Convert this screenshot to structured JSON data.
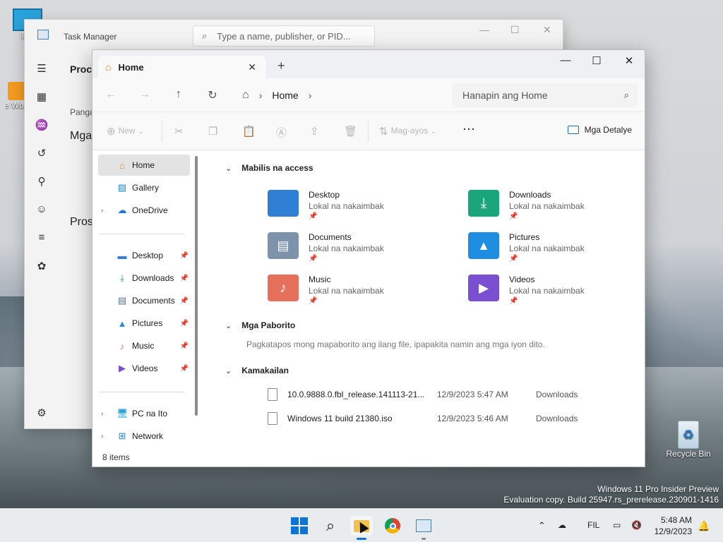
{
  "desktop": {
    "icons": [
      {
        "label": "PC"
      },
      {
        "label": "VMware Workstation"
      },
      {
        "label": "Recycle Bin"
      }
    ],
    "watermark": {
      "line1": "Windows 11 Pro Insider Preview",
      "line2": "Evaluation copy. Build 25947.rs_prerelease.230901-1416"
    }
  },
  "task_manager": {
    "title": "Task Manager",
    "search_placeholder": "Type a name, publisher, or PID...",
    "visible_texts": {
      "proc": "Proce",
      "panga": "Panga",
      "mga": "Mga",
      "pros": "Pros"
    }
  },
  "explorer": {
    "tab_label": "Home",
    "breadcrumb": "Home",
    "search_placeholder": "Hanapin ang Home",
    "toolbar": {
      "new_label": "New",
      "sort_label": "Mag-ayos",
      "details_label": "Mga Detalye"
    },
    "sidebar": {
      "top": [
        {
          "label": "Home",
          "icon": "home-icon"
        },
        {
          "label": "Gallery",
          "icon": "gallery-icon"
        },
        {
          "label": "OneDrive",
          "icon": "cloud-icon"
        }
      ],
      "pinned": [
        {
          "label": "Desktop",
          "icon": "desktop-icon"
        },
        {
          "label": "Downloads",
          "icon": "download-icon"
        },
        {
          "label": "Documents",
          "icon": "document-icon"
        },
        {
          "label": "Pictures",
          "icon": "picture-icon"
        },
        {
          "label": "Music",
          "icon": "music-icon"
        },
        {
          "label": "Videos",
          "icon": "video-icon"
        }
      ],
      "bottom": [
        {
          "label": "PC na Ito",
          "icon": "pc-icon"
        },
        {
          "label": "Network",
          "icon": "network-icon"
        }
      ]
    },
    "sections": {
      "quick_access": "Mabilis na access",
      "favorites": "Mga Paborito",
      "recent": "Kamakailan"
    },
    "quick_access": [
      {
        "name": "Desktop",
        "sub": "Lokal na nakaimbak",
        "color": "#2f7fd4"
      },
      {
        "name": "Downloads",
        "sub": "Lokal na nakaimbak",
        "color": "#1aa57a"
      },
      {
        "name": "Documents",
        "sub": "Lokal na nakaimbak",
        "color": "#7d93ac"
      },
      {
        "name": "Pictures",
        "sub": "Lokal na nakaimbak",
        "color": "#1f8ee0"
      },
      {
        "name": "Music",
        "sub": "Lokal na nakaimbak",
        "color": "#e46f5a"
      },
      {
        "name": "Videos",
        "sub": "Lokal na nakaimbak",
        "color": "#7a4fd1"
      }
    ],
    "favorites_empty": "Pagkatapos mong mapaborito ang ilang file, ipapakita namin ang mga iyon dito.",
    "recent": [
      {
        "name": "10.0.9888.0.fbl_release.141113-21...",
        "date": "12/9/2023 5:47 AM",
        "location": "Downloads"
      },
      {
        "name": "Windows 11 build 21380.iso",
        "date": "12/9/2023 5:46 AM",
        "location": "Downloads"
      }
    ],
    "status": "8 items"
  },
  "taskbar": {
    "lang": "FIL",
    "time": "5:48 AM",
    "date": "12/9/2023"
  }
}
